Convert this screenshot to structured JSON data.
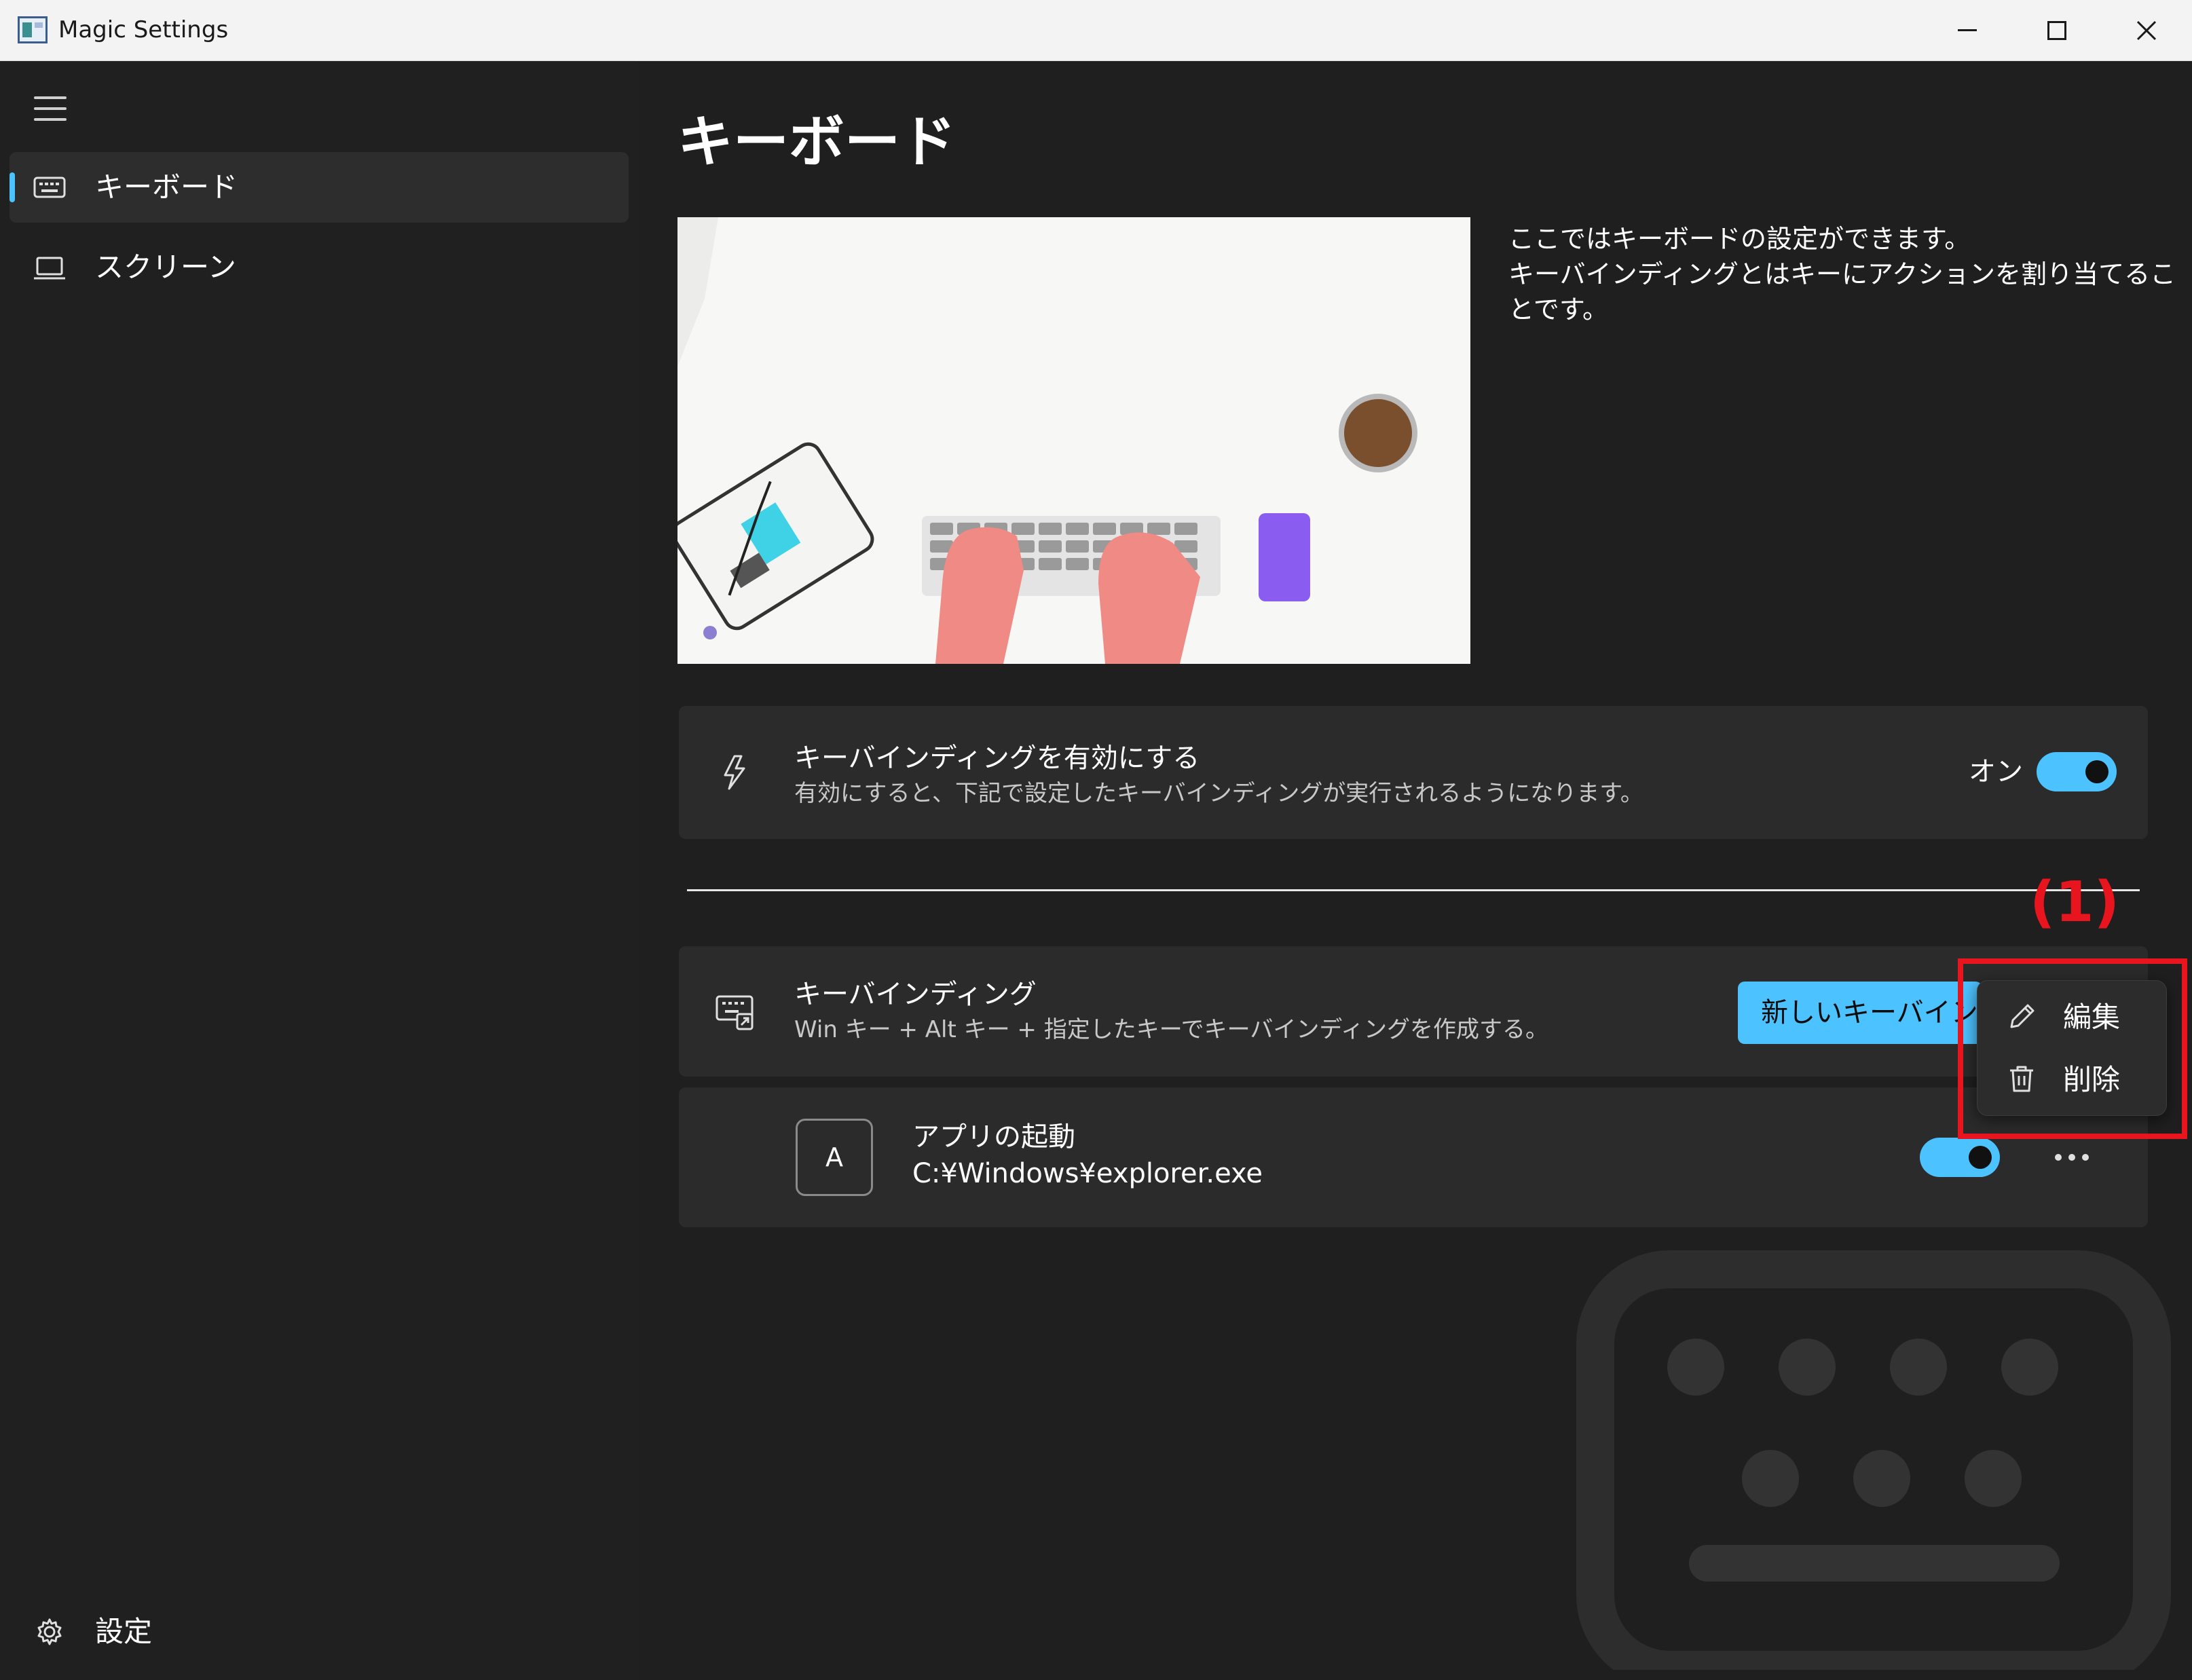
{
  "window": {
    "title": "Magic Settings",
    "controls": [
      "minimize-icon",
      "maximize-icon",
      "close-icon"
    ]
  },
  "sidebar": {
    "menu_icon": "hamburger-icon",
    "items": [
      {
        "label": "キーボード",
        "icon": "keyboard-icon",
        "selected": true
      },
      {
        "label": "スクリーン",
        "icon": "laptop-icon",
        "selected": false
      }
    ],
    "footer": {
      "label": "設定",
      "icon": "gear-icon"
    }
  },
  "main": {
    "title": "キーボード",
    "intro_lines": [
      "ここではキーボードの設定ができます。",
      "キーバインディングとはキーにアクションを割り当てることです。"
    ],
    "enable_card": {
      "icon": "lightning-icon",
      "title": "キーバインディングを有効にする",
      "description": "有効にすると、下記で設定したキーバインディングが実行されるようになります。",
      "state_label": "オン",
      "enabled": true
    },
    "bindings_card": {
      "icon": "keyboard-shortcut-icon",
      "title": "キーバインディング",
      "description": "Win キー + Alt キー + 指定したキーでキーバインディングを作成する。",
      "new_button_label": "新しいキーバインディング"
    },
    "binding_items": [
      {
        "key": "A",
        "title": "アプリの起動",
        "path": "C:¥Windows¥explorer.exe",
        "enabled": true,
        "more_icon": "more-icon"
      }
    ]
  },
  "context_menu": {
    "items": [
      {
        "label": "編集",
        "icon": "pencil-icon"
      },
      {
        "label": "削除",
        "icon": "trash-icon"
      }
    ]
  },
  "annotation": {
    "label": "(1)",
    "color": "#e8151f"
  },
  "colors": {
    "accent": "#4cc2ff",
    "background": "#1f1f1f",
    "card": "#2b2b2b"
  }
}
